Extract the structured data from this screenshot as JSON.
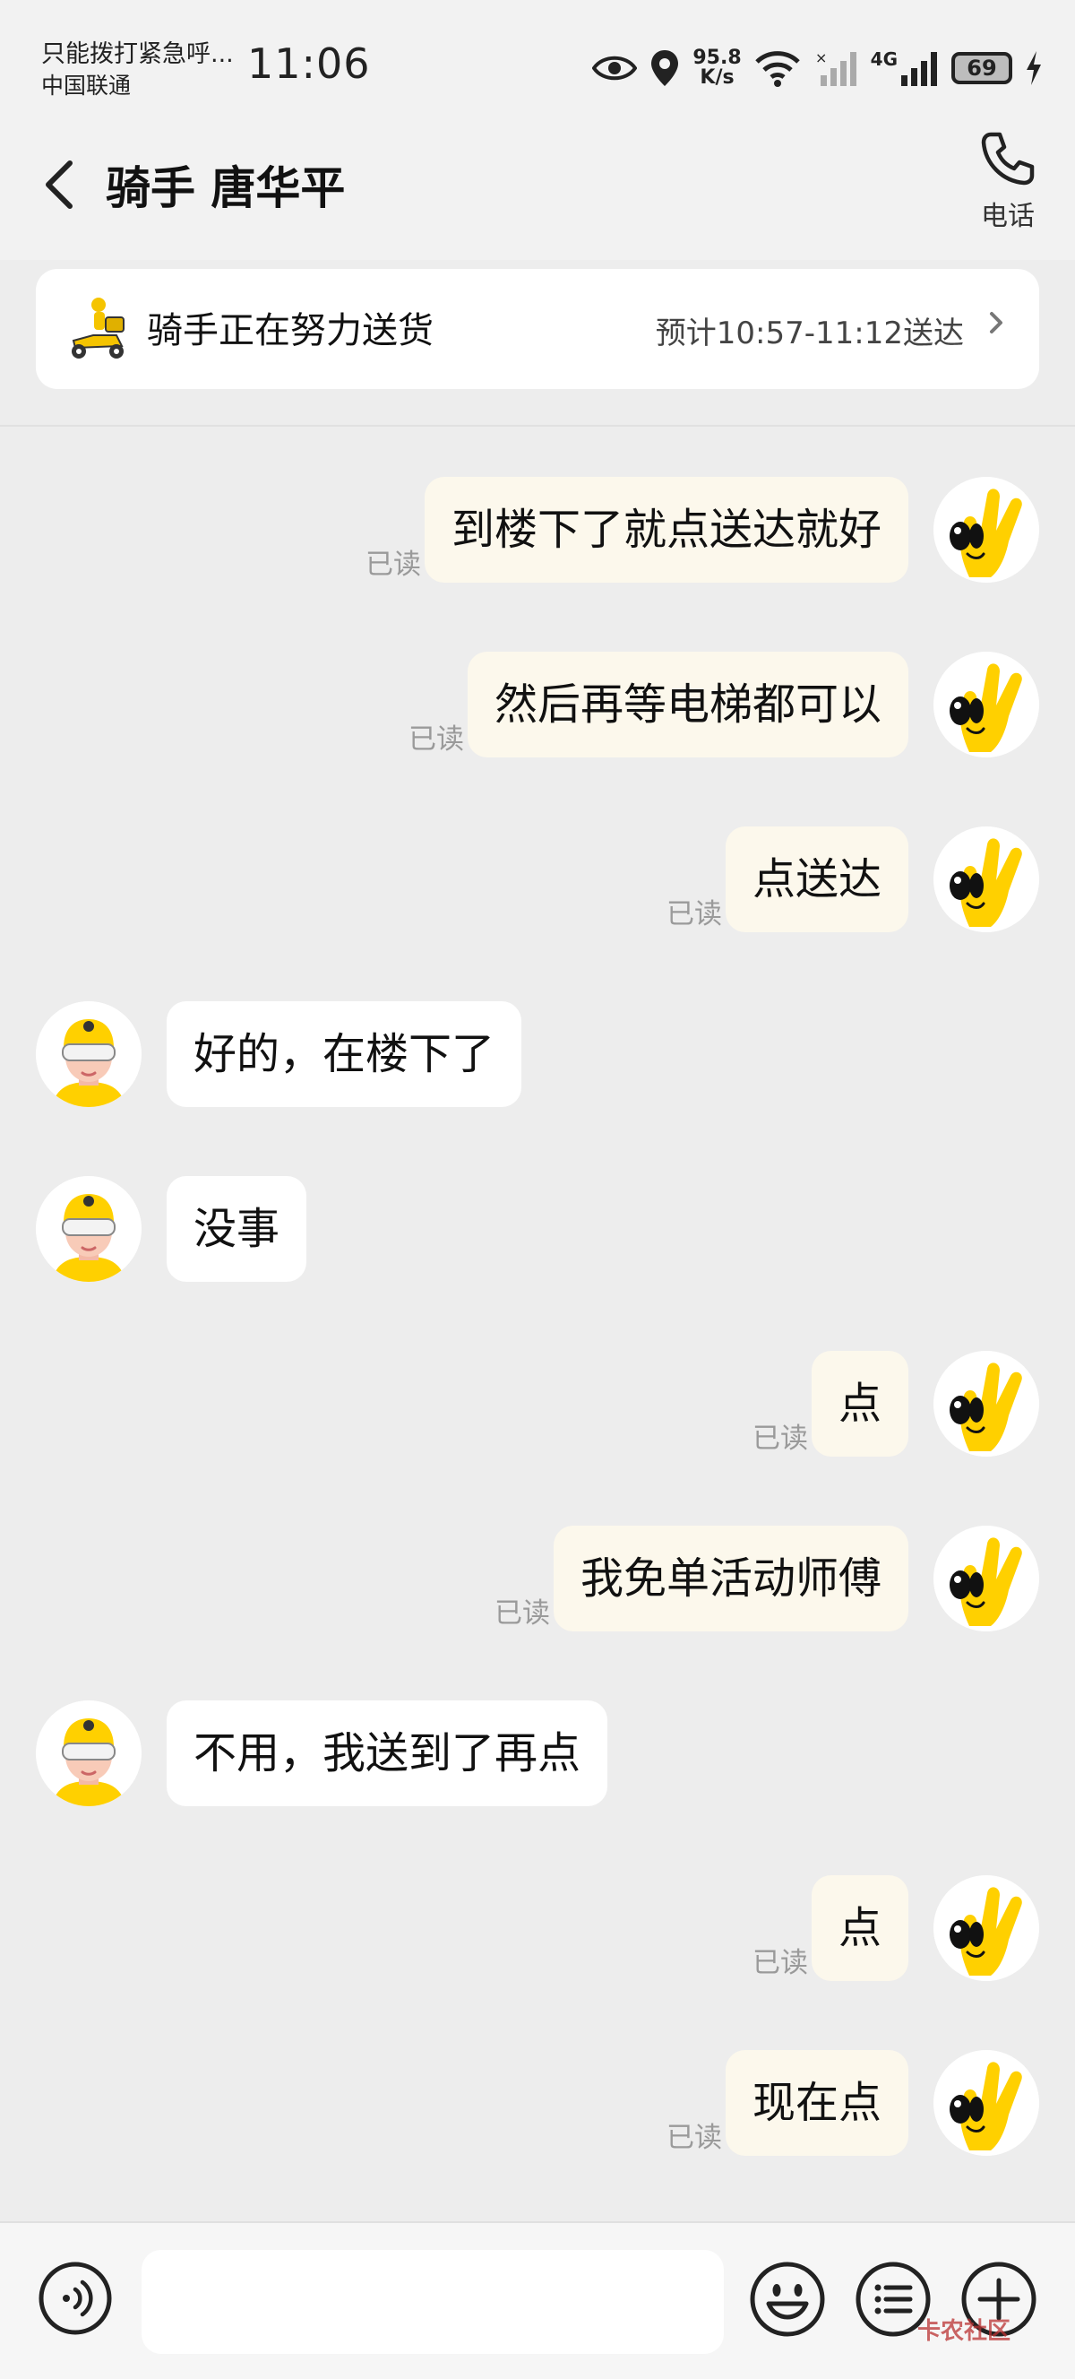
{
  "status_bar": {
    "carrier_line1": "只能拨打紧急呼...",
    "carrier_line2": "中国联通",
    "time": "11:06",
    "net_speed_value": "95.8",
    "net_speed_unit": "K/s",
    "network_type": "4G",
    "battery": "69"
  },
  "header": {
    "title": "骑手 唐华平",
    "call_label": "电话"
  },
  "delivery_card": {
    "status": "骑手正在努力送货",
    "eta": "预计10:57-11:12送达"
  },
  "chat": {
    "read_label": "已读",
    "messages": [
      {
        "from": "me",
        "text": "到楼下了就点送达就好",
        "read": true
      },
      {
        "from": "me",
        "text": "然后再等电梯都可以",
        "read": true
      },
      {
        "from": "me",
        "text": "点送达",
        "read": true
      },
      {
        "from": "rider",
        "text": "好的，在楼下了"
      },
      {
        "from": "rider",
        "text": "没事"
      },
      {
        "from": "me",
        "text": "点",
        "read": true
      },
      {
        "from": "me",
        "text": "我免单活动师傅",
        "read": true
      },
      {
        "from": "rider",
        "text": "不用，我送到了再点"
      },
      {
        "from": "me",
        "text": "点",
        "read": true
      },
      {
        "from": "me",
        "text": "现在点",
        "read": true
      }
    ]
  },
  "input_bar": {
    "watermark": "卡农社区"
  },
  "colors": {
    "background": "#ededed",
    "my_bubble": "#fcf8ec",
    "rider_bubble": "#ffffff",
    "brand_yellow": "#ffd000"
  }
}
